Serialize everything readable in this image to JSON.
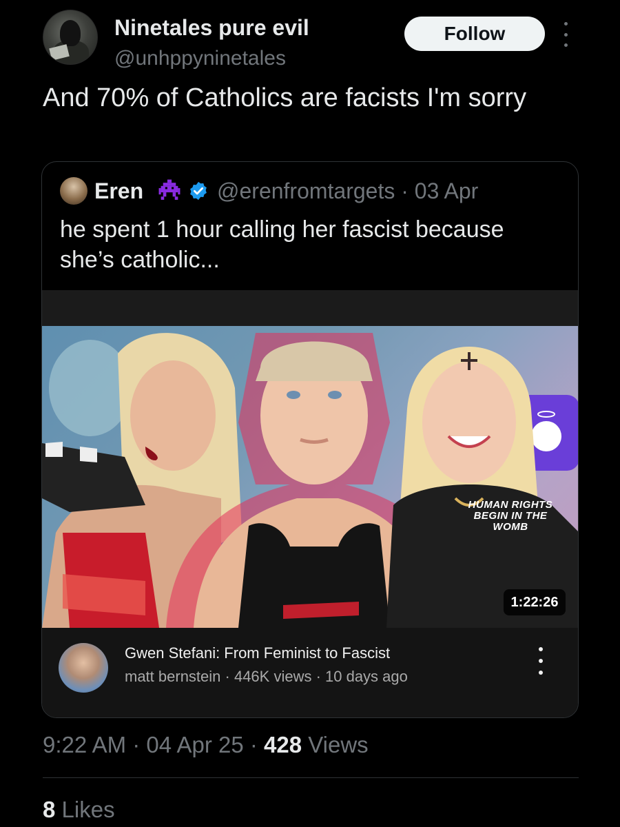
{
  "tweet": {
    "display_name": "Ninetales pure evil",
    "handle": "@unhppyninetales",
    "follow_label": "Follow",
    "text": "And 70% of Catholics are facists I'm sorry"
  },
  "quoted": {
    "name": "Eren",
    "handle_date": "@erenfromtargets · 03 Apr",
    "text": "he spent 1 hour calling her fascist because she’s catholic...",
    "video": {
      "overlay_text": "HUMAN RIGHTS BEGIN IN THE WOMB",
      "duration": "1:22:26",
      "title": "Gwen Stefani: From Feminist to Fascist",
      "meta": "matt bernstein · 446K views · 10 days ago"
    }
  },
  "footer": {
    "time_date": "9:22 AM · 04 Apr 25 · ",
    "views_count": "428",
    "views_label": " Views",
    "likes_count": "8",
    "likes_label": " Likes"
  },
  "colors": {
    "background": "#000000",
    "text_primary": "#e7e9ea",
    "text_secondary": "#71767b",
    "verified_blue": "#1d9bf0",
    "alien_purple": "#8a2be2",
    "border": "#2f3336"
  },
  "icons": [
    "more-icon",
    "alien-icon",
    "verified-icon",
    "kebab-icon"
  ]
}
